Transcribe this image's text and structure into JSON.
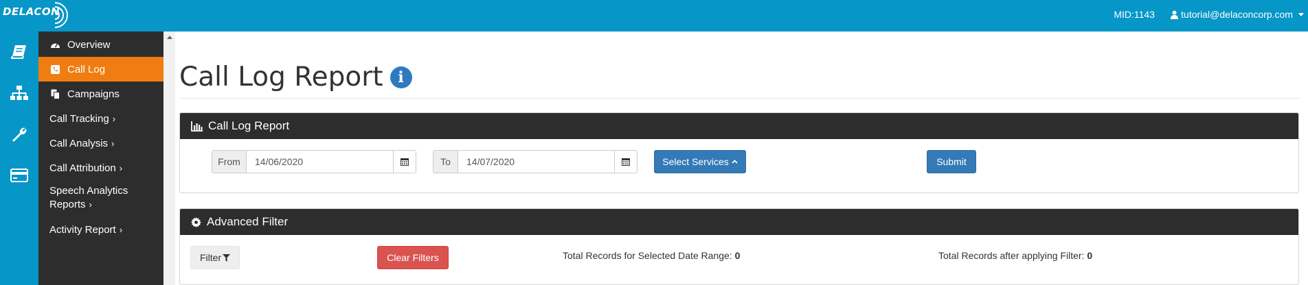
{
  "brand": {
    "logo_text": "DELACON"
  },
  "header": {
    "mid": "MID:1143",
    "user_email": "tutorial@delaconcorp.com"
  },
  "rail": {
    "icons": [
      "book-icon",
      "sitemap-icon",
      "wrench-icon",
      "card-icon"
    ]
  },
  "sidebar": {
    "items": [
      {
        "label": "Overview",
        "icon": "dashboard-icon"
      },
      {
        "label": "Call Log",
        "icon": "phone-icon",
        "active": true
      },
      {
        "label": "Campaigns",
        "icon": "copy-icon"
      },
      {
        "label": "Call Tracking",
        "chevron": "›"
      },
      {
        "label": "Call Analysis",
        "chevron": "›"
      },
      {
        "label": "Call Attribution",
        "chevron": "›"
      },
      {
        "label_line1": "Speech Analytics",
        "label_line2": "Reports",
        "chevron": "›"
      },
      {
        "label": "Activity Report",
        "chevron": "›"
      }
    ]
  },
  "page": {
    "title": "Call Log Report",
    "info_glyph": "i"
  },
  "report_panel": {
    "title": "Call Log Report",
    "from_label": "From",
    "from_value": "14/06/2020",
    "to_label": "To",
    "to_value": "14/07/2020",
    "select_services_label": "Select Services",
    "submit_label": "Submit"
  },
  "filter_panel": {
    "title": "Advanced Filter",
    "filter_label": "Filter",
    "clear_label": "Clear Filters",
    "total_selected_label": "Total Records for Selected Date Range:",
    "total_selected_value": "0",
    "total_filtered_label": "Total Records after applying Filter:",
    "total_filtered_value": "0"
  },
  "colors": {
    "brand_blue": "#0696c7",
    "active_orange": "#ef7d11",
    "sidebar_dark": "#2d2d2d",
    "primary": "#337ab7",
    "danger": "#d9534f"
  }
}
